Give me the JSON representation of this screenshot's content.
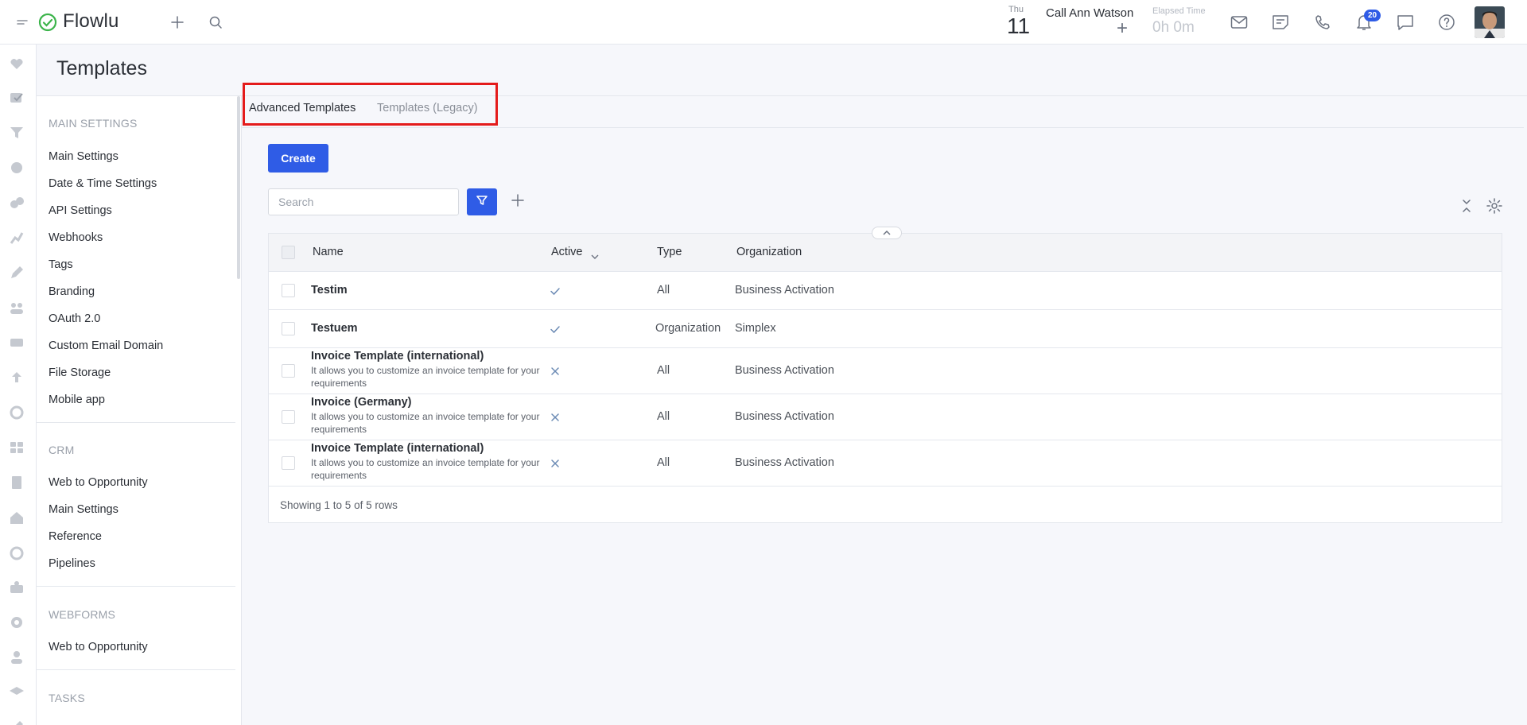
{
  "app": {
    "name": "Flowlu"
  },
  "topbar": {
    "date_dow": "Thu",
    "date_num": "11",
    "call_name": "Call Ann Watson",
    "call_plus": "+",
    "elapsed_label": "Elapsed Time",
    "elapsed_value": "0h 0m",
    "notifications_count": "20",
    "icons": [
      "menu-icon",
      "logo-icon",
      "plus-icon",
      "search-icon",
      "mail-icon",
      "notes-icon",
      "phone-icon",
      "bell-icon",
      "chat-icon",
      "help-icon"
    ]
  },
  "page": {
    "title": "Templates"
  },
  "sidebar": {
    "sections": [
      {
        "title": "MAIN SETTINGS",
        "items": [
          "Main Settings",
          "Date & Time Settings",
          "API Settings",
          "Webhooks",
          "Tags",
          "Branding",
          "OAuth 2.0",
          "Custom Email Domain",
          "File Storage",
          "Mobile app"
        ]
      },
      {
        "title": "CRM",
        "items": [
          "Web to Opportunity",
          "Main Settings",
          "Reference",
          "Pipelines"
        ]
      },
      {
        "title": "WEBFORMS",
        "items": [
          "Web to Opportunity"
        ]
      },
      {
        "title": "TASKS",
        "items": []
      }
    ]
  },
  "tabs": [
    {
      "label": "Advanced Templates",
      "active": true
    },
    {
      "label": "Templates (Legacy)",
      "active": false
    }
  ],
  "toolbar": {
    "create_label": "Create",
    "search_placeholder": "Search"
  },
  "table": {
    "columns": [
      "Name",
      "Active",
      "Type",
      "Organization"
    ],
    "rows": [
      {
        "name": "Testim",
        "description": "",
        "active": true,
        "type": "All",
        "organization": "Business Activation"
      },
      {
        "name": "Testuem",
        "description": "",
        "active": true,
        "type": "Organization",
        "organization": "Simplex"
      },
      {
        "name": "Invoice Template (international)",
        "description": "It allows you to customize an invoice template for your requirements",
        "active": false,
        "type": "All",
        "organization": "Business Activation"
      },
      {
        "name": "Invoice (Germany)",
        "description": "It allows you to customize an invoice template for your requirements",
        "active": false,
        "type": "All",
        "organization": "Business Activation"
      },
      {
        "name": "Invoice Template (international)",
        "description": "It allows you to customize an invoice template for your requirements",
        "active": false,
        "type": "All",
        "organization": "Business Activation"
      }
    ],
    "footer": "Showing 1 to 5 of 5 rows"
  },
  "colors": {
    "accent": "#2f5ce6",
    "highlight": "#e41b1b",
    "logo_green": "#3cb44b"
  }
}
